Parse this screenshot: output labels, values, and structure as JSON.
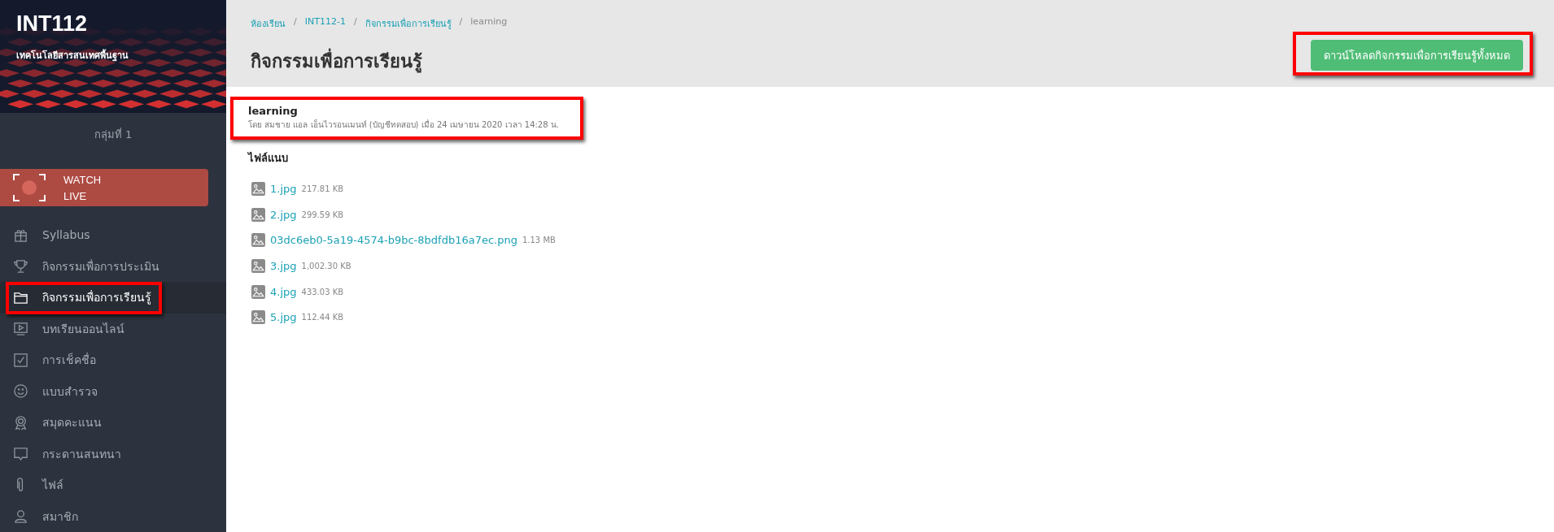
{
  "sidebar": {
    "course_code": "INT112",
    "course_name": "เทคโนโลยีสารสนเทศพื้นฐาน",
    "group": "กลุ่มที่ 1",
    "live_button": {
      "line_1": "WATCH",
      "line_2": "LIVE"
    },
    "items": [
      {
        "kind": "gift",
        "label": "Syllabus",
        "selected": false,
        "highlighted": false
      },
      {
        "kind": "trophy",
        "label": "กิจกรรมเพื่อการประเมิน",
        "selected": false,
        "highlighted": false
      },
      {
        "kind": "folder",
        "label": "กิจกรรมเพื่อการเรียนรู้",
        "selected": true,
        "highlighted": true
      },
      {
        "kind": "video",
        "label": "บทเรียนออนไลน์",
        "selected": false,
        "highlighted": false
      },
      {
        "kind": "check",
        "label": "การเช็คชื่อ",
        "selected": false,
        "highlighted": false
      },
      {
        "kind": "smile",
        "label": "แบบสำรวจ",
        "selected": false,
        "highlighted": false
      },
      {
        "kind": "award",
        "label": "สมุดคะแนน",
        "selected": false,
        "highlighted": false
      },
      {
        "kind": "chat",
        "label": "กระดานสนทนา",
        "selected": false,
        "highlighted": false
      },
      {
        "kind": "clip",
        "label": "ไฟล์",
        "selected": false,
        "highlighted": false
      },
      {
        "kind": "user",
        "label": "สมาชิก",
        "selected": false,
        "highlighted": false
      }
    ]
  },
  "breadcrumb_separator": "/",
  "breadcrumb": [
    {
      "label": "ห้องเรียน",
      "link": true
    },
    {
      "label": "INT112-1",
      "link": true
    },
    {
      "label": "กิจกรรมเพื่อการเรียนรู้",
      "link": true
    },
    {
      "label": "learning",
      "link": false
    }
  ],
  "page_title": "กิจกรรมเพื่อการเรียนรู้",
  "download_button": {
    "label": "ดาวน์โหลดกิจกรรมเพื่อการเรียนรู้ทั้งหมด",
    "highlighted": true
  },
  "post": {
    "title": "learning",
    "meta": "โดย สมชาย แอล เอ็นไวรอนเมนท์ (บัญชีทดสอบ) เมื่อ 24 เมษายน 2020 เวลา 14:28 น.",
    "highlighted": true
  },
  "attachments_heading": "ไฟล์แนบ",
  "attachments": [
    {
      "name": "1.jpg",
      "size": "217.81 KB"
    },
    {
      "name": "2.jpg",
      "size": "299.59 KB"
    },
    {
      "name": "03dc6eb0-5a19-4574-b9bc-8bdfdb16a7ec.png",
      "size": "1.13 MB"
    },
    {
      "name": "3.jpg",
      "size": "1,002.30 KB"
    },
    {
      "name": "4.jpg",
      "size": "433.03 KB"
    },
    {
      "name": "5.jpg",
      "size": "112.44 KB"
    }
  ]
}
